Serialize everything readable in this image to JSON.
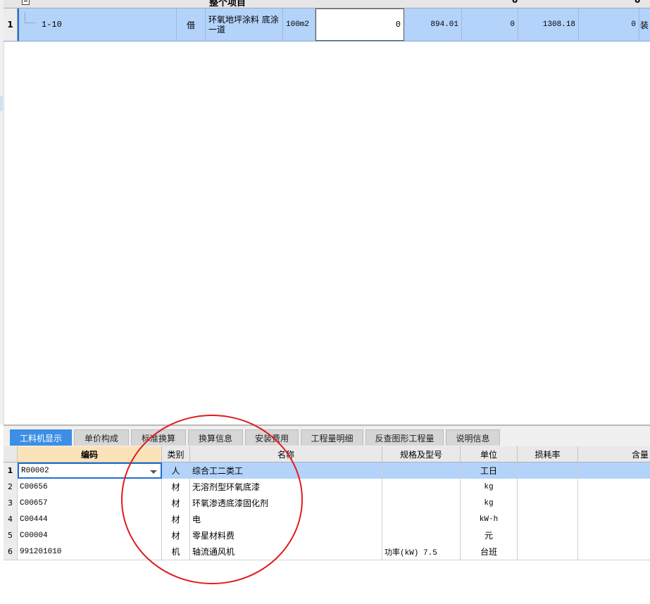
{
  "top_grid": {
    "group_row": {
      "title": "整个项目",
      "value_1": "0",
      "value_2": "0"
    },
    "row": {
      "row_number": "1",
      "code": "1-10",
      "type": "借",
      "name": "环氧地坪涂料 底涂一道",
      "unit": "100m2",
      "quantity": "0",
      "col_1": "894.01",
      "col_2": "0",
      "col_3": "1308.18",
      "col_4": "0",
      "col_5": "装"
    }
  },
  "tabs": [
    {
      "label": "工料机显示",
      "active": true
    },
    {
      "label": "单价构成",
      "active": false
    },
    {
      "label": "标准换算",
      "active": false
    },
    {
      "label": "换算信息",
      "active": false
    },
    {
      "label": "安装费用",
      "active": false
    },
    {
      "label": "工程量明细",
      "active": false
    },
    {
      "label": "反查图形工程量",
      "active": false
    },
    {
      "label": "说明信息",
      "active": false
    }
  ],
  "resource_grid": {
    "headers": [
      "编码",
      "类别",
      "名称",
      "规格及型号",
      "单位",
      "损耗率",
      "含量"
    ],
    "rows": [
      {
        "no": "1",
        "code": "R00002",
        "category": "人",
        "name": "综合工二类工",
        "spec": "",
        "unit": "工日",
        "loss": "",
        "content": ""
      },
      {
        "no": "2",
        "code": "C00656",
        "category": "材",
        "name": "无溶剂型环氧底漆",
        "spec": "",
        "unit": "kg",
        "loss": "",
        "content": ""
      },
      {
        "no": "3",
        "code": "C00657",
        "category": "材",
        "name": "环氧渗透底漆固化剂",
        "spec": "",
        "unit": "kg",
        "loss": "",
        "content": ""
      },
      {
        "no": "4",
        "code": "C00444",
        "category": "材",
        "name": "电",
        "spec": "",
        "unit": "kW·h",
        "loss": "",
        "content": ""
      },
      {
        "no": "5",
        "code": "C00004",
        "category": "材",
        "name": "零星材料费",
        "spec": "",
        "unit": "元",
        "loss": "",
        "content": ""
      },
      {
        "no": "6",
        "code": "991201010",
        "category": "机",
        "name": "轴流通风机",
        "spec": "功率(kW) 7.5",
        "unit": "台班",
        "loss": "",
        "content": ""
      }
    ]
  },
  "annotation": {
    "color": "#e01b1b"
  }
}
